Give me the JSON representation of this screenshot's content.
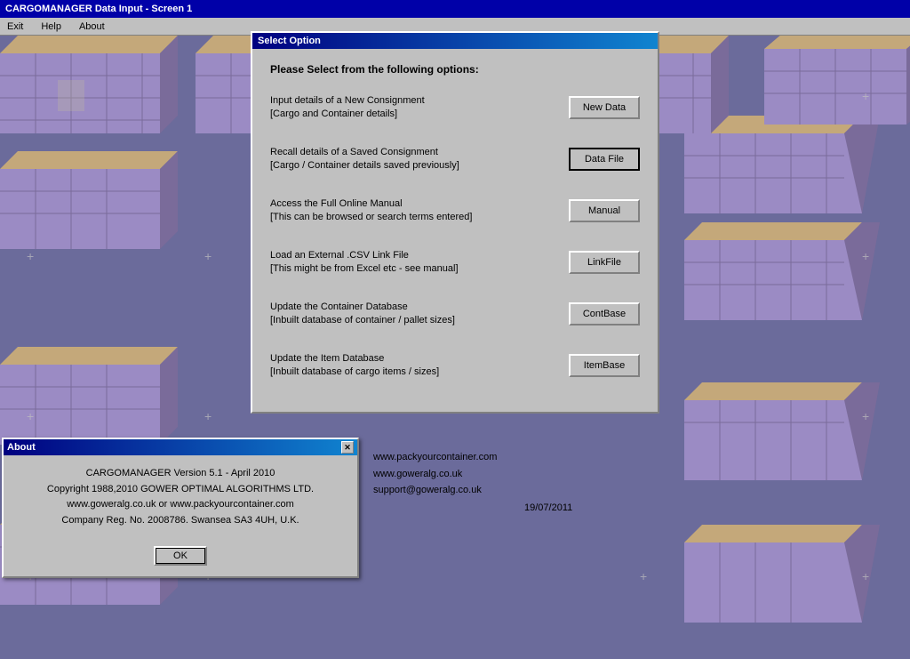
{
  "app": {
    "title": "CARGOMANAGER Data Input - Screen 1"
  },
  "menu": {
    "items": [
      "Exit",
      "Help",
      "About"
    ]
  },
  "main_dialog": {
    "title": "Select Option",
    "heading": "Please Select from the following options:",
    "options": [
      {
        "id": "new-data",
        "line1": "Input details of a New Consignment",
        "line2": "[Cargo and Container details]",
        "button": "New Data"
      },
      {
        "id": "data-file",
        "line1": "Recall details of a Saved Consignment",
        "line2": "[Cargo / Container details saved previously]",
        "button": "Data File"
      },
      {
        "id": "manual",
        "line1": "Access the Full Online Manual",
        "line2": "[This can be browsed or search terms entered]",
        "button": "Manual"
      },
      {
        "id": "link-file",
        "line1": "Load an External .CSV Link File",
        "line2": "[This might be from Excel etc - see manual]",
        "button": "LinkFile"
      },
      {
        "id": "cont-base",
        "line1": "Update the Container Database",
        "line2": "[Inbuilt database of container / pallet sizes]",
        "button": "ContBase"
      },
      {
        "id": "item-base",
        "line1": "Update the Item Database",
        "line2": "[Inbuilt database of cargo items / sizes]",
        "button": "ItemBase"
      }
    ]
  },
  "about_dialog": {
    "title": "About",
    "lines": [
      "CARGOMANAGER Version 5.1 - April 2010",
      "Copyright 1988,2010 GOWER OPTIMAL ALGORITHMS LTD.",
      "www.goweralg.co.uk or www.packyourcontainer.com",
      "Company Reg. No. 2008786.    Swansea SA3 4UH, U.K."
    ],
    "ok_button": "OK",
    "right_links": [
      "www.packyourcontainer.com",
      "www.goweralg.co.uk",
      "support@goweralg.co.uk"
    ],
    "date": "19/07/2011"
  },
  "colors": {
    "title_bar_bg": "#0000a8",
    "dialog_bg": "#c0c0c0",
    "bg_color": "#6b6b9b",
    "container_color": "#9b8bc4",
    "container_side": "#7a6b9a",
    "container_top": "#c4a87a"
  }
}
